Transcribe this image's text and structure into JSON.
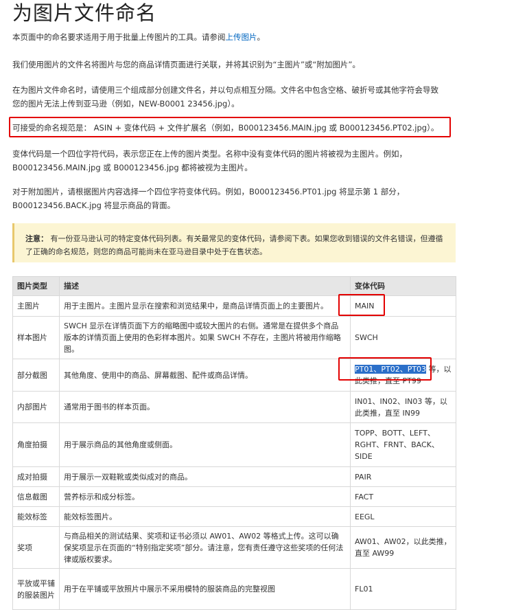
{
  "page": {
    "title": "为图片文件命名",
    "intro_prefix": "本页面中的命名要求适用于用于批量上传图片的工具。请参阅",
    "intro_link": "上传图片",
    "intro_suffix": "。",
    "para2": "我们使用图片的文件名将图片与您的商品详情页面进行关联，并将其识别为“主图片”或“附加图片”。",
    "para3": "在为图片文件命名时，请使用三个组成部分创建文件名，并以句点相互分隔。文件名中包含空格、破折号或其他字符会导致您的图片无法上传到亚马逊（例如，NEW-B0001 23456.jpg）。",
    "para4": "可接受的命名规范是： ASIN + 变体代码 + 文件扩展名（例如，B000123456.MAIN.jpg 或 B000123456.PT02.jpg）。",
    "para5": "变体代码是一个四位字符代码，表示您正在上传的图片类型。名称中没有变体代码的图片将被视为主图片。例如，B000123456.MAIN.jpg 或 B000123456.jpg 都将被视为主图片。",
    "para6": "对于附加图片，请根据图片内容选择一个四位字符变体代码。例如，B000123456.PT01.jpg 将显示第 1 部分，B000123456.BACK.jpg 将显示商品的背面。"
  },
  "note": {
    "label": "注意：",
    "text": "有一份亚马逊认可的特定变体代码列表。有关最常见的变体代码，请参阅下表。如果您收到错误的文件名错误，但遵循了正确的命名规范，则您的商品可能尚未在亚马逊目录中处于在售状态。"
  },
  "table": {
    "headers": [
      "图片类型",
      "描述",
      "变体代码"
    ],
    "rows": [
      {
        "type": "主图片",
        "desc": "用于主图片。主图片显示在搜索和浏览结果中，是商品详情页面上的主要图片。",
        "code": "MAIN"
      },
      {
        "type": "样本图片",
        "desc": "SWCH 显示在详情页面下方的缩略图中或较大图片的右侧。通常是在提供多个商品版本的详情页面上使用的色彩样本图片。如果 SWCH 不存在，主图片将被用作缩略图。",
        "code": "SWCH"
      },
      {
        "type": "部分截图",
        "desc": "其他角度、使用中的商品、屏幕截图、配件或商品详情。",
        "code_highlight": "PT01、PT02、PT03",
        "code_rest": " 等，以此类推，直至 PT99"
      },
      {
        "type": "内部图片",
        "desc": "通常用于图书的样本页面。",
        "code": "IN01、IN02、IN03 等，以此类推，直至 IN99"
      },
      {
        "type": "角度拍摄",
        "desc": "用于展示商品的其他角度或侧面。",
        "code": "TOPP、BOTT、LEFT、RGHT、FRNT、BACK、SIDE"
      },
      {
        "type": "成对拍摄",
        "desc": "用于展示一双鞋靴或类似成对的商品。",
        "code": "PAIR"
      },
      {
        "type": "信息截图",
        "desc": "营养标示和成分标签。",
        "code": "FACT"
      },
      {
        "type": "能效标签",
        "desc": "能效标签图片。",
        "code": "EEGL"
      },
      {
        "type": "奖项",
        "desc": "与商品相关的测试结果、奖项和证书必须以 AW01、AW02 等格式上传。这可以确保奖项显示在页面的“特别指定奖项”部分。请注意，您有责任遵守这些奖项的任何法律或版权要求。",
        "code": "AW01、AW02，以此类推，直至 AW99"
      },
      {
        "type": "平放或平铺的服装图片",
        "desc": "用于在平铺或平放照片中展示不采用模特的服装商品的完整视图",
        "code": "FL01"
      }
    ]
  },
  "colors": {
    "highlight_box": "#e30000",
    "link": "#0066c0",
    "note_bg": "#fcf5d3",
    "selection": "#2b6fc9"
  }
}
